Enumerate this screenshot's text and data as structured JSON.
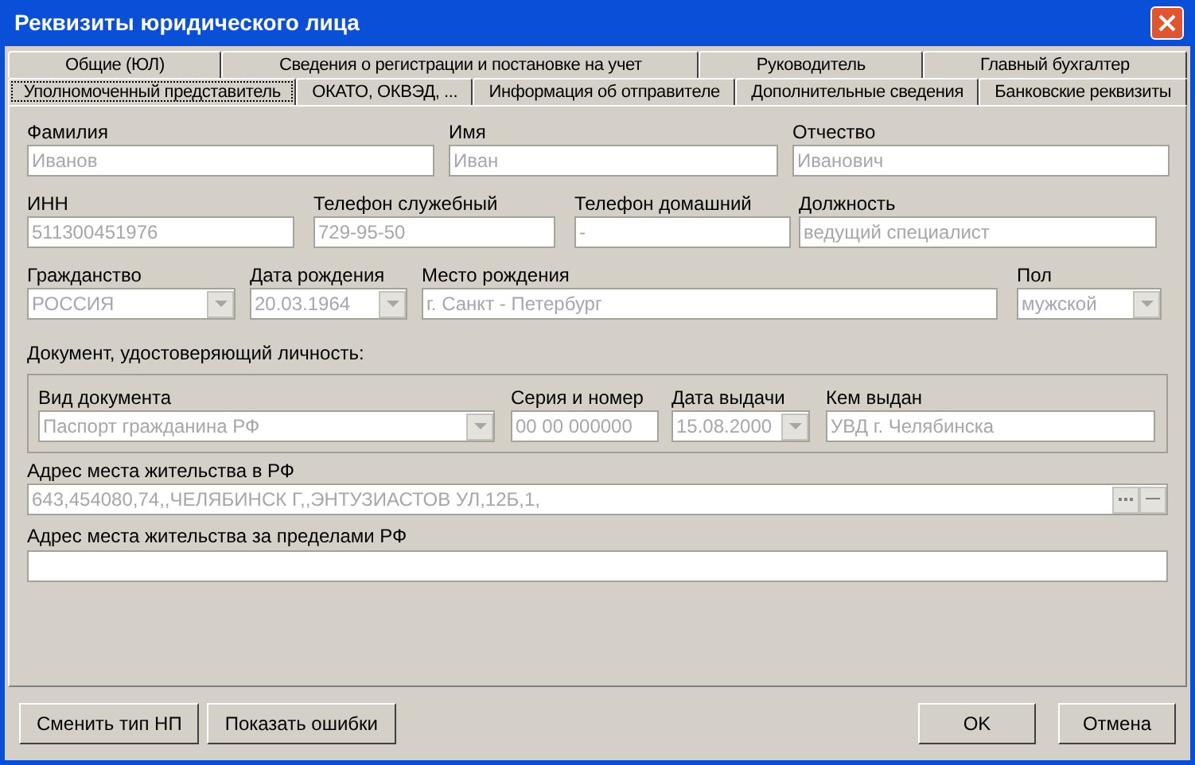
{
  "window": {
    "title": "Реквизиты юридического лица"
  },
  "tab_rows": [
    [
      {
        "label": "Общие (ЮЛ)",
        "selected": false
      },
      {
        "label": "Сведения о регистрации и постановке на учет",
        "selected": false
      },
      {
        "label": "Руководитель",
        "selected": false
      },
      {
        "label": "Главный бухгалтер",
        "selected": false
      }
    ],
    [
      {
        "label": "Уполномоченный представитель",
        "selected": true
      },
      {
        "label": "ОКАТО, ОКВЭД, ...",
        "selected": false
      },
      {
        "label": "Информация об отправителе",
        "selected": false
      },
      {
        "label": "Дополнительные сведения",
        "selected": false
      },
      {
        "label": "Банковские реквизиты",
        "selected": false
      }
    ]
  ],
  "rows": [
    [
      {
        "label": "Фамилия",
        "kind": "text",
        "value": "Иванов",
        "disabled": true
      },
      {
        "label": "Имя",
        "kind": "text",
        "value": "Иван",
        "disabled": true
      },
      {
        "label": "Отчество",
        "kind": "text",
        "value": "Иванович",
        "disabled": true
      }
    ],
    [
      {
        "label": "ИНН",
        "kind": "text",
        "value": "511300451976",
        "disabled": true
      },
      {
        "label": "Телефон служебный",
        "kind": "text",
        "value": "729-95-50",
        "disabled": true
      },
      {
        "label": "Телефон домашний",
        "kind": "text",
        "value": "-",
        "disabled": true
      },
      {
        "label": "Должность",
        "kind": "text",
        "value": "ведущий специалист",
        "disabled": true
      }
    ],
    [
      {
        "label": "Гражданство",
        "kind": "combo",
        "value": "РОССИЯ",
        "disabled": true
      },
      {
        "label": "Дата рождения",
        "kind": "combo",
        "value": "20.03.1964",
        "disabled": true
      },
      {
        "label": "Место рождения",
        "kind": "text",
        "value": "г. Санкт - Петербург",
        "disabled": true
      },
      {
        "label": "Пол",
        "kind": "combo",
        "value": "мужской",
        "disabled": true
      }
    ]
  ],
  "document": {
    "title": "Документ, удостоверяющий личность:",
    "fields": [
      {
        "label": "Вид документа",
        "kind": "combo",
        "value": "Паспорт гражданина РФ",
        "disabled": true
      },
      {
        "label": "Серия и номер",
        "kind": "text",
        "value": "00 00 000000",
        "disabled": true
      },
      {
        "label": "Дата выдачи",
        "kind": "combo",
        "value": "15.08.2000",
        "disabled": true
      },
      {
        "label": "Кем выдан",
        "kind": "text",
        "value": "УВД г. Челябинска",
        "disabled": true
      }
    ]
  },
  "address": {
    "label": "Адрес места жительства в РФ",
    "value": "643,454080,74,,ЧЕЛЯБИНСК Г,,ЭНТУЗИАСТОВ УЛ,12Б,1,",
    "disabled": true
  },
  "address_abroad": {
    "label": "Адрес места жительства за пределами РФ",
    "disabled": false
  },
  "buttons_left": [
    "Сменить тип НП",
    "Показать ошибки"
  ],
  "buttons_right": [
    "OK",
    "Отмена"
  ]
}
